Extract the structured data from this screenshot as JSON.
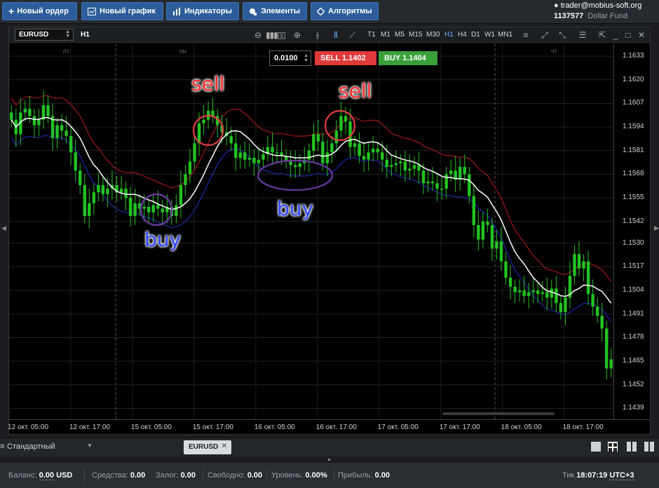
{
  "toolbar": {
    "new_order": "Новый ордер",
    "new_chart": "Новый график",
    "indicators": "Индикаторы",
    "elements": "Элементы",
    "algorithms": "Алгоритмы"
  },
  "account": {
    "user": "trader@mobius-soft.org",
    "number": "1137577",
    "fund": "Dollar Fund"
  },
  "chart": {
    "symbol": "EURUSD",
    "timeframe_label": "H1",
    "timeframes": [
      "T1",
      "M1",
      "M5",
      "M15",
      "M30",
      "H1",
      "H4",
      "D1",
      "W1",
      "MN1"
    ],
    "active_timeframe": "H1",
    "lot": "0.0100",
    "sell_label": "SELL 1.1402",
    "buy_label": "BUY 1.1404",
    "day_labels": [
      "пт",
      "пн",
      "чт"
    ],
    "y_ticks": [
      "1.1633",
      "1.1620",
      "1.1607",
      "1.1594",
      "1.1581",
      "1.1568",
      "1.1555",
      "1.1542",
      "1.1530",
      "1.1517",
      "1.1504",
      "1.1491",
      "1.1478",
      "1.1465",
      "1.1452",
      "1.1439"
    ],
    "x_ticks": [
      "12 окт. 05:00",
      "12 окт. 17:00",
      "15 окт. 05:00",
      "15 окт. 17:00",
      "16 окт. 05:00",
      "16 окт. 17:00",
      "17 окт. 05:00",
      "17 окт. 17:00",
      "18 окт. 05:00",
      "18 окт. 17:00"
    ],
    "annotations": {
      "sell1": "sell",
      "sell2": "sell",
      "buy1": "buy",
      "buy2": "buy"
    },
    "colors": {
      "bull": "#22c322",
      "upper_band": "#a01818",
      "lower_band": "#1a2aa8",
      "middle": "#ffffff",
      "sell_circle": "#e24040",
      "buy_circle": "#6a3aa0"
    }
  },
  "chart_data": {
    "type": "candlestick",
    "ylim": [
      1.1433,
      1.164
    ],
    "closes": [
      1.1598,
      1.159,
      1.1602,
      1.1604,
      1.16,
      1.1595,
      1.1598,
      1.1606,
      1.16,
      1.1588,
      1.1595,
      1.1592,
      1.1589,
      1.158,
      1.157,
      1.1562,
      1.1545,
      1.1552,
      1.1558,
      1.1562,
      1.1557,
      1.156,
      1.1562,
      1.1558,
      1.156,
      1.1555,
      1.1545,
      1.1552,
      1.1549,
      1.155,
      1.1547,
      1.1551,
      1.1549,
      1.1547,
      1.155,
      1.1545,
      1.1551,
      1.1562,
      1.1568,
      1.1575,
      1.1585,
      1.1596,
      1.1598,
      1.1603,
      1.16,
      1.1595,
      1.1591,
      1.1589,
      1.1585,
      1.1577,
      1.158,
      1.1576,
      1.1577,
      1.1574,
      1.1576,
      1.1579,
      1.1583,
      1.158,
      1.158,
      1.1578,
      1.1575,
      1.1573,
      1.1572,
      1.1574,
      1.1576,
      1.1581,
      1.159,
      1.1586,
      1.1574,
      1.158,
      1.1585,
      1.1592,
      1.16,
      1.1597,
      1.1583,
      1.1585,
      1.1578,
      1.1576,
      1.158,
      1.1582,
      1.158,
      1.1576,
      1.1572,
      1.1573,
      1.1574,
      1.1575,
      1.157,
      1.1571,
      1.1573,
      1.157,
      1.1563,
      1.1564,
      1.1563,
      1.156,
      1.156,
      1.1568,
      1.157,
      1.1565,
      1.1572,
      1.1568,
      1.1556,
      1.154,
      1.1532,
      1.1542,
      1.154,
      1.1527,
      1.1531,
      1.152,
      1.1511,
      1.1506,
      1.1503,
      1.1504,
      1.1501,
      1.1503,
      1.1504,
      1.1502,
      1.1503,
      1.15,
      1.1505,
      1.1497,
      1.1492,
      1.15,
      1.1512,
      1.1524,
      1.1516,
      1.152,
      1.1502,
      1.1495,
      1.149,
      1.1483,
      1.1461,
      1.1466
    ],
    "x_ticks": [
      "12 окт. 05:00",
      "12 окт. 17:00",
      "15 окт. 05:00",
      "15 окт. 17:00",
      "16 окт. 05:00",
      "16 окт. 17:00",
      "17 окт. 05:00",
      "17 окт. 17:00",
      "18 окт. 05:00",
      "18 окт. 17:00"
    ],
    "y_ticks": [
      1.1633,
      1.162,
      1.1607,
      1.1594,
      1.1581,
      1.1568,
      1.1555,
      1.1542,
      1.153,
      1.1517,
      1.1504,
      1.1491,
      1.1478,
      1.1465,
      1.1452,
      1.1439
    ]
  },
  "bottom": {
    "workspace": "Стандартный",
    "tab": "EURUSD"
  },
  "status": {
    "balance_label": "Баланс:",
    "balance_value": "0.00",
    "balance_ccy": "USD",
    "funds_label": "Средства:",
    "funds_value": "0.00",
    "margin_label": "Залог:",
    "margin_value": "0.00",
    "free_label": "Свободно:",
    "free_value": "0.00",
    "level_label": "Уровень:",
    "level_value": "0.00%",
    "profit_label": "Прибыль:",
    "profit_value": "0.00",
    "tick_label": "Тик",
    "time": "18:07:19",
    "tz": "UTC+3"
  }
}
